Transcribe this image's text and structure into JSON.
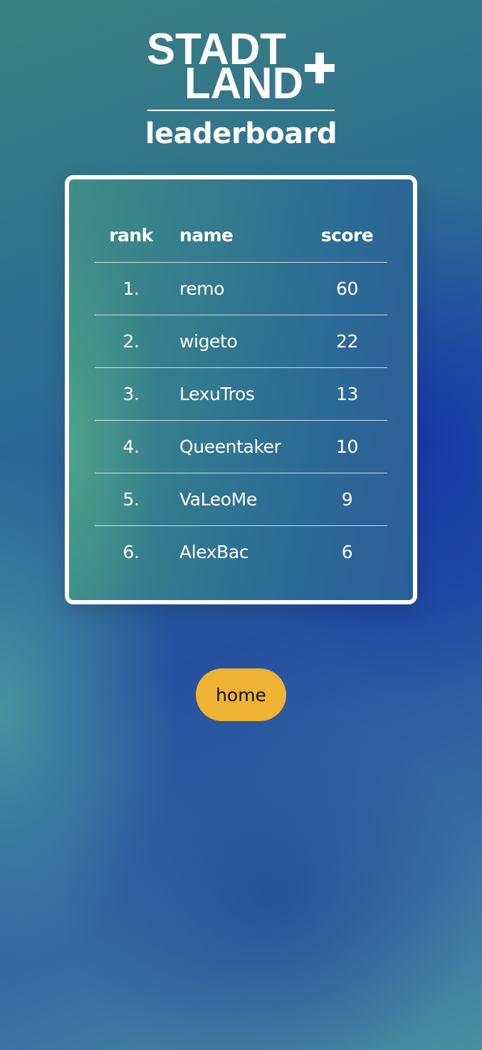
{
  "logo": {
    "line1": "STADT",
    "line2": "LAND",
    "plus": "+"
  },
  "page": {
    "title": "leaderboard"
  },
  "leaderboard": {
    "columns": {
      "rank": "rank",
      "name": "name",
      "score": "score"
    },
    "rows": [
      {
        "rank": "1.",
        "name": "remo",
        "score": "60"
      },
      {
        "rank": "2.",
        "name": "wigeto",
        "score": "22"
      },
      {
        "rank": "3.",
        "name": "LexuTros",
        "score": "13"
      },
      {
        "rank": "4.",
        "name": "Queentaker",
        "score": "10"
      },
      {
        "rank": "5.",
        "name": "VaLeoMe",
        "score": "9"
      },
      {
        "rank": "6.",
        "name": "AlexBac",
        "score": "6"
      }
    ]
  },
  "nav": {
    "home_label": "home"
  },
  "colors": {
    "accent_button": "#efb232",
    "text": "#ffffff"
  }
}
